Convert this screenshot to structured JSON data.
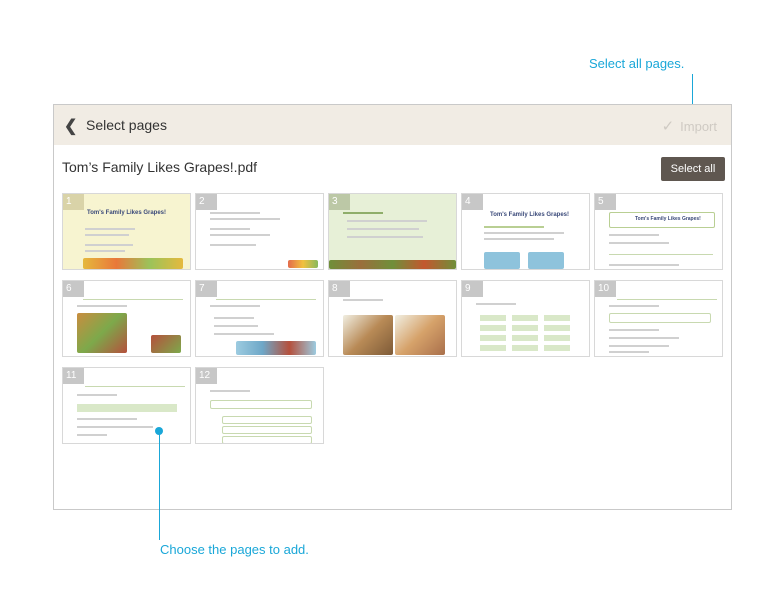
{
  "callouts": {
    "select_all_hint": "Select all pages.",
    "choose_hint": "Choose the pages to add."
  },
  "header": {
    "back_icon": "chevron-left-icon",
    "title": "Select pages",
    "import_label": "Import",
    "import_icon": "check-icon"
  },
  "file": {
    "name": "Tom’s Family Likes Grapes!.pdf",
    "select_all_label": "Select all"
  },
  "pages": [
    {
      "number": "1",
      "title": "Tom's Family Likes Grapes!"
    },
    {
      "number": "2",
      "title": ""
    },
    {
      "number": "3",
      "title": ""
    },
    {
      "number": "4",
      "title": "Tom's Family Likes Grapes!"
    },
    {
      "number": "5",
      "title": "Tom's Family Likes Grapes!"
    },
    {
      "number": "6",
      "title": ""
    },
    {
      "number": "7",
      "title": ""
    },
    {
      "number": "8",
      "title": ""
    },
    {
      "number": "9",
      "title": ""
    },
    {
      "number": "10",
      "title": ""
    },
    {
      "number": "11",
      "title": ""
    },
    {
      "number": "12",
      "title": ""
    }
  ],
  "colors": {
    "accent": "#1aa7d8",
    "page_number_bg": "#c7c7c7",
    "topbar_bg": "#f1ece4",
    "select_all_bg": "#5f5750"
  }
}
